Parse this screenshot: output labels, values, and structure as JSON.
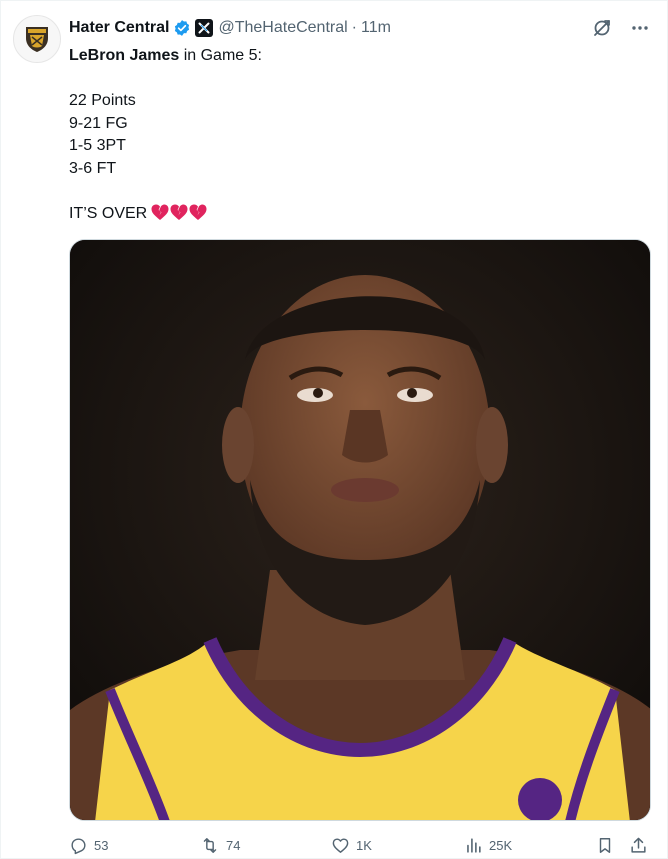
{
  "tweet": {
    "author": {
      "display_name": "Hater Central",
      "handle": "@TheHateCentral",
      "separator": "·",
      "time": "11m",
      "verified_icon": "verified-badge-icon",
      "affiliate_icon": "x-affiliate-icon"
    },
    "text": {
      "name": "LeBron James",
      "intro_rest": " in Game 5:",
      "stats": [
        "22 Points",
        "9-21 FG",
        "1-5 3PT",
        "3-6 FT"
      ],
      "closing": "IT’S OVER",
      "closing_emoji": "broken-heart-icon x3"
    },
    "media": {
      "alt": "LeBron James in a yellow Lakers jersey looking up with a frustrated expression"
    },
    "actions": {
      "replies": "53",
      "reposts": "74",
      "likes": "1K",
      "views": "25K"
    },
    "colors": {
      "text": "#0f1419",
      "muted": "#536471",
      "verified": "#1d9bf0",
      "jersey_gold": "#f6d44a",
      "jersey_purple": "#552583",
      "broken_heart": "#e0245e"
    }
  }
}
